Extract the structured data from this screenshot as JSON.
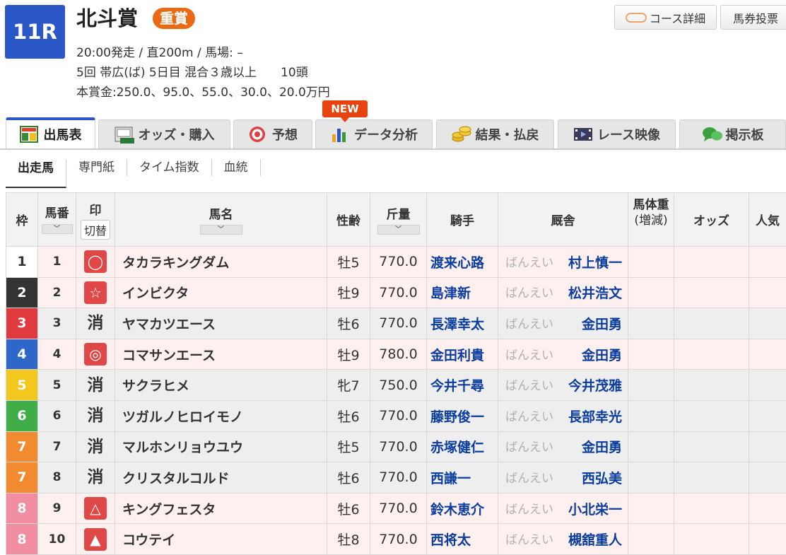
{
  "race": {
    "number": "11R",
    "name": "北斗賞",
    "grade": "重賞",
    "line1": "20:00発走 / 直200m / 馬場: –",
    "line2": "5回 帯広(ば) 5日目 混合３歳以上　　10頭",
    "line3": "本賞金:250.0、95.0、55.0、30.0、20.0万円"
  },
  "top_buttons": {
    "course": "コース詳細",
    "bet": "馬券投票"
  },
  "tabs": [
    {
      "label": "出馬表",
      "active": true
    },
    {
      "label": "オッズ・購入"
    },
    {
      "label": "予想"
    },
    {
      "label": "データ分析"
    },
    {
      "label": "結果・払戻"
    },
    {
      "label": "レース映像"
    },
    {
      "label": "掲示板"
    }
  ],
  "new_badge": "NEW",
  "subtabs": [
    "出走馬",
    "専門紙",
    "タイム指数",
    "血統"
  ],
  "table": {
    "headers": {
      "waku": "枠",
      "umaban": "馬番",
      "mark": "印",
      "switch": "切替",
      "name": "馬名",
      "age": "性齢",
      "weight": "斤量",
      "jockey": "騎手",
      "stable": "厩舎",
      "body": "馬体重",
      "body_sub": "(増減)",
      "odds": "オッズ",
      "popular": "人気"
    },
    "sort_symbol": "﹀",
    "rows": [
      {
        "waku": "1",
        "waku_color": "#ffffff",
        "waku_text": "#333333",
        "umaban": "1",
        "mark": "◯",
        "mark_type": "red",
        "name": "タカラキングダム",
        "age": "牡5",
        "weight": "770.0",
        "jockey": "渡来心路",
        "region": "ばんえい",
        "trainer": "村上慎一",
        "bg": "pink"
      },
      {
        "waku": "2",
        "waku_color": "#333333",
        "waku_text": "#ffffff",
        "umaban": "2",
        "mark": "☆",
        "mark_type": "red",
        "name": "インビクタ",
        "age": "牡9",
        "weight": "770.0",
        "jockey": "島津新",
        "region": "ばんえい",
        "trainer": "松井浩文",
        "bg": "pink"
      },
      {
        "waku": "3",
        "waku_color": "#e0393e",
        "waku_text": "#ffffff",
        "umaban": "3",
        "mark": "消",
        "mark_type": "shou",
        "name": "ヤマカツエース",
        "age": "牡6",
        "weight": "770.0",
        "jockey": "長澤幸太",
        "region": "ばんえい",
        "trainer": "金田勇",
        "bg": "gray"
      },
      {
        "waku": "4",
        "waku_color": "#2e67c8",
        "waku_text": "#ffffff",
        "umaban": "4",
        "mark": "◎",
        "mark_type": "red",
        "name": "コマサンエース",
        "age": "牡9",
        "weight": "780.0",
        "jockey": "金田利貴",
        "region": "ばんえい",
        "trainer": "金田勇",
        "bg": "pink"
      },
      {
        "waku": "5",
        "waku_color": "#f2c81e",
        "waku_text": "#ffffff",
        "umaban": "5",
        "mark": "消",
        "mark_type": "shou",
        "name": "サクラヒメ",
        "age": "牝7",
        "weight": "750.0",
        "jockey": "今井千尋",
        "region": "ばんえい",
        "trainer": "今井茂雅",
        "bg": "gray"
      },
      {
        "waku": "6",
        "waku_color": "#3fae49",
        "waku_text": "#ffffff",
        "umaban": "6",
        "mark": "消",
        "mark_type": "shou",
        "name": "ツガルノヒロイモノ",
        "age": "牡6",
        "weight": "770.0",
        "jockey": "藤野俊一",
        "region": "ばんえい",
        "trainer": "長部幸光",
        "bg": "gray"
      },
      {
        "waku": "7",
        "waku_color": "#f28a30",
        "waku_text": "#ffffff",
        "umaban": "7",
        "mark": "消",
        "mark_type": "shou",
        "name": "マルホンリョウユウ",
        "age": "牡5",
        "weight": "770.0",
        "jockey": "赤塚健仁",
        "region": "ばんえい",
        "trainer": "金田勇",
        "bg": "gray"
      },
      {
        "waku": "7",
        "waku_color": "#f28a30",
        "waku_text": "#ffffff",
        "umaban": "8",
        "mark": "消",
        "mark_type": "shou",
        "name": "クリスタルコルド",
        "age": "牡6",
        "weight": "770.0",
        "jockey": "西謙一",
        "region": "ばんえい",
        "trainer": "西弘美",
        "bg": "gray"
      },
      {
        "waku": "8",
        "waku_color": "#f08da0",
        "waku_text": "#ffffff",
        "umaban": "9",
        "mark": "△",
        "mark_type": "red",
        "name": "キングフェスタ",
        "age": "牡6",
        "weight": "770.0",
        "jockey": "鈴木恵介",
        "region": "ばんえい",
        "trainer": "小北栄一",
        "bg": "pink"
      },
      {
        "waku": "8",
        "waku_color": "#f08da0",
        "waku_text": "#ffffff",
        "umaban": "10",
        "mark": "▲",
        "mark_type": "red",
        "name": "コウテイ",
        "age": "牡8",
        "weight": "770.0",
        "jockey": "西将太",
        "region": "ばんえい",
        "trainer": "槻舘重人",
        "bg": "pink"
      }
    ]
  },
  "colors": {
    "accent": "#2a56c6",
    "grade": "#ea6a14",
    "link": "#0a3d9e",
    "mark": "#e04848"
  }
}
